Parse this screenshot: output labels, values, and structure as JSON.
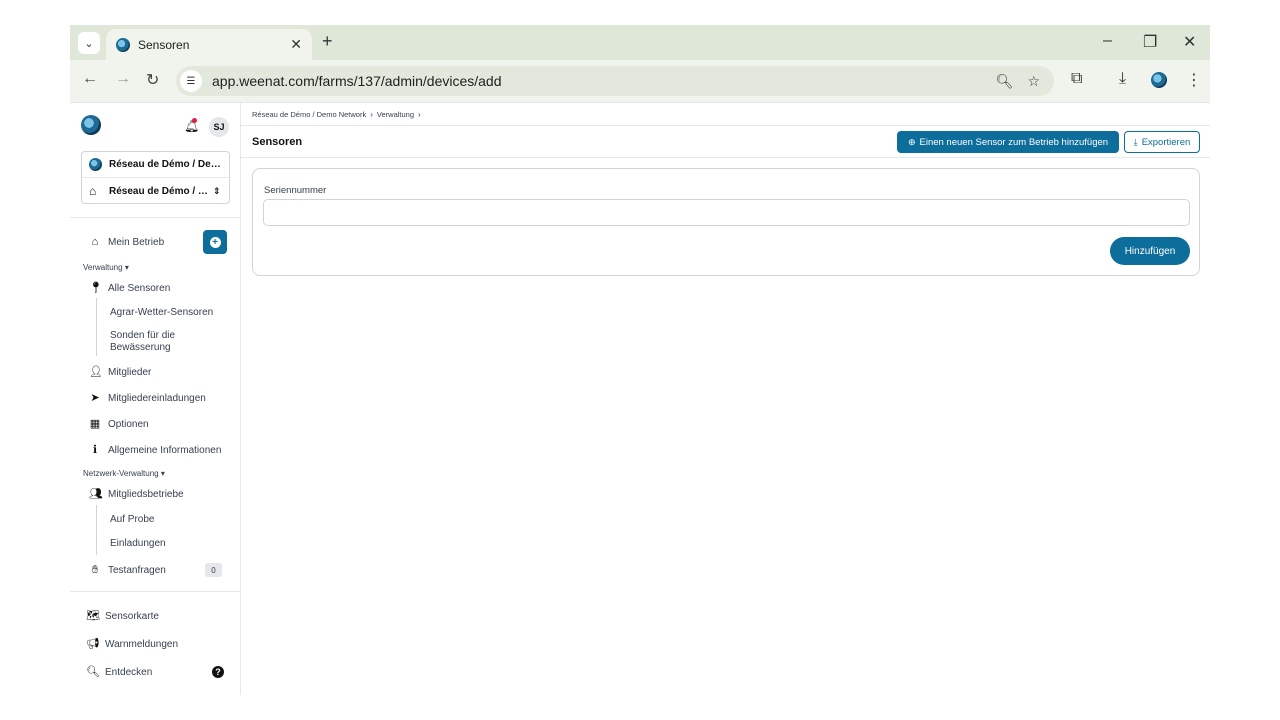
{
  "browser": {
    "tab_title": "Sensoren",
    "tab_close": "✕",
    "new_tab": "+",
    "url": "app.weenat.com/farms/137/admin/devices/add"
  },
  "sidebar": {
    "avatar_initials": "SJ",
    "network_name": "Réseau de Démo / Demo Network",
    "farm_name": "Réseau de Démo / Demo Network",
    "my_farm": "Mein Betrieb",
    "section_admin": "Verwaltung",
    "items_admin": {
      "all_sensors": "Alle Sensoren",
      "agri_weather": "Agrar-Wetter-Sensoren",
      "irrigation_probes": "Sonden für die Bewässerung",
      "members": "Mitglieder",
      "member_invitations": "Mitgliedereinladungen",
      "options": "Optionen",
      "general_info": "Allgemeine Informationen"
    },
    "section_network": "Netzwerk-Verwaltung",
    "items_network": {
      "member_farms": "Mitgliedsbetriebe",
      "on_trial": "Auf Probe",
      "invitations": "Einladungen",
      "test_requests": "Testanfragen",
      "test_requests_count": "0"
    },
    "bottom": {
      "sensor_map": "Sensorkarte",
      "alerts": "Warnmeldungen",
      "discover": "Entdecken",
      "help": "?"
    }
  },
  "breadcrumb": {
    "network": "Réseau de Démo / Demo Network",
    "admin": "Verwaltung"
  },
  "page": {
    "title": "Sensoren",
    "add_sensor_button": "Einen neuen Sensor zum Betrieb hinzufügen",
    "export_button": "Exportieren"
  },
  "form": {
    "serial_label": "Seriennummer",
    "serial_value": "",
    "submit_label": "Hinzufügen"
  },
  "colors": {
    "primary": "#0e6e9b",
    "browser_chrome": "#dfe7d9"
  }
}
